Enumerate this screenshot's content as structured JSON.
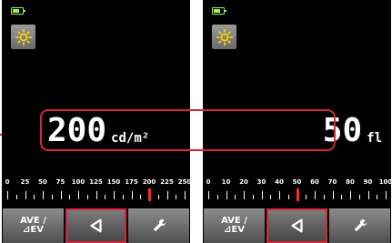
{
  "colors": {
    "accent": "#d8243d",
    "battery": "#9df05a",
    "marker": "#ff2a2a"
  },
  "icons": {
    "settings": "sun-icon",
    "back": "triangle-left-icon",
    "tools": "wrench-icon",
    "battery": "battery-icon"
  },
  "left_screen": {
    "value": "200",
    "unit": "cd/m²",
    "scale_labels": [
      "0",
      "25",
      "50",
      "75",
      "100",
      "125",
      "150",
      "175",
      "200",
      "225",
      "250"
    ],
    "marker_value": 200,
    "ave_label_line1": "AVE /",
    "ave_label_line2": "⊿EV"
  },
  "right_screen": {
    "value": "50",
    "unit": "fl",
    "scale_labels": [
      "0",
      "10",
      "20",
      "30",
      "40",
      "50",
      "60",
      "70",
      "80",
      "90",
      "100"
    ],
    "marker_value": 50,
    "ave_label_line1": "AVE /",
    "ave_label_line2": "⊿EV"
  }
}
